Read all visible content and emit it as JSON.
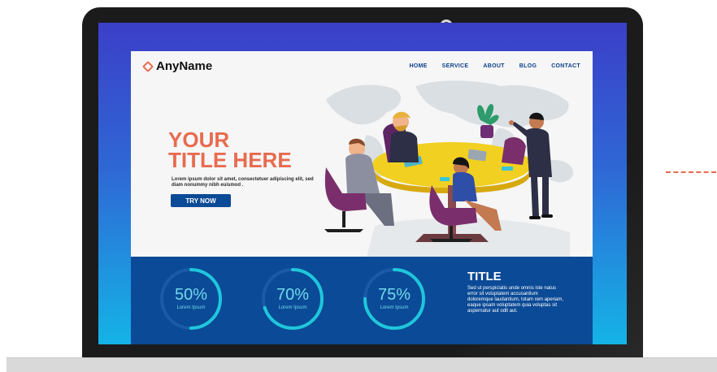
{
  "brand": {
    "name": "AnyName"
  },
  "nav": {
    "items": [
      "HOME",
      "SERVICE",
      "ABOUT",
      "BLOG",
      "CONTACT"
    ]
  },
  "hero": {
    "title_line1": "YOUR",
    "title_line2": "TITLE HERE",
    "body": "Lorem ipsum dolor sit amet, consectetuer adipiscing elit, sed diam nonummy nibh euismod .",
    "cta_label": "TRY NOW"
  },
  "stats": [
    {
      "value": "50%",
      "label": "Lorem Ipsum",
      "progress": 0.5
    },
    {
      "value": "70%",
      "label": "Lorem Ipsum",
      "progress": 0.7
    },
    {
      "value": "75%",
      "label": "Lorem Ipsum",
      "progress": 0.75
    }
  ],
  "info": {
    "title": "TITLE",
    "body": "Sed ut perspiciatis unde omnis iste natus error sit voluptatem accusantium doloremque laudantium, totam rem aperiam, eaque ipsam voluptatem quia voluptas sit aspernatur aut odit aut."
  },
  "colors": {
    "accent": "#e86b4f",
    "primary": "#0b4a96",
    "ring": "#1fc6dc",
    "screen_top": "#3b3fc8",
    "screen_bottom": "#14b3e6"
  },
  "icons": [
    "logo-diamond-icon",
    "world-map",
    "meeting-illustration"
  ]
}
